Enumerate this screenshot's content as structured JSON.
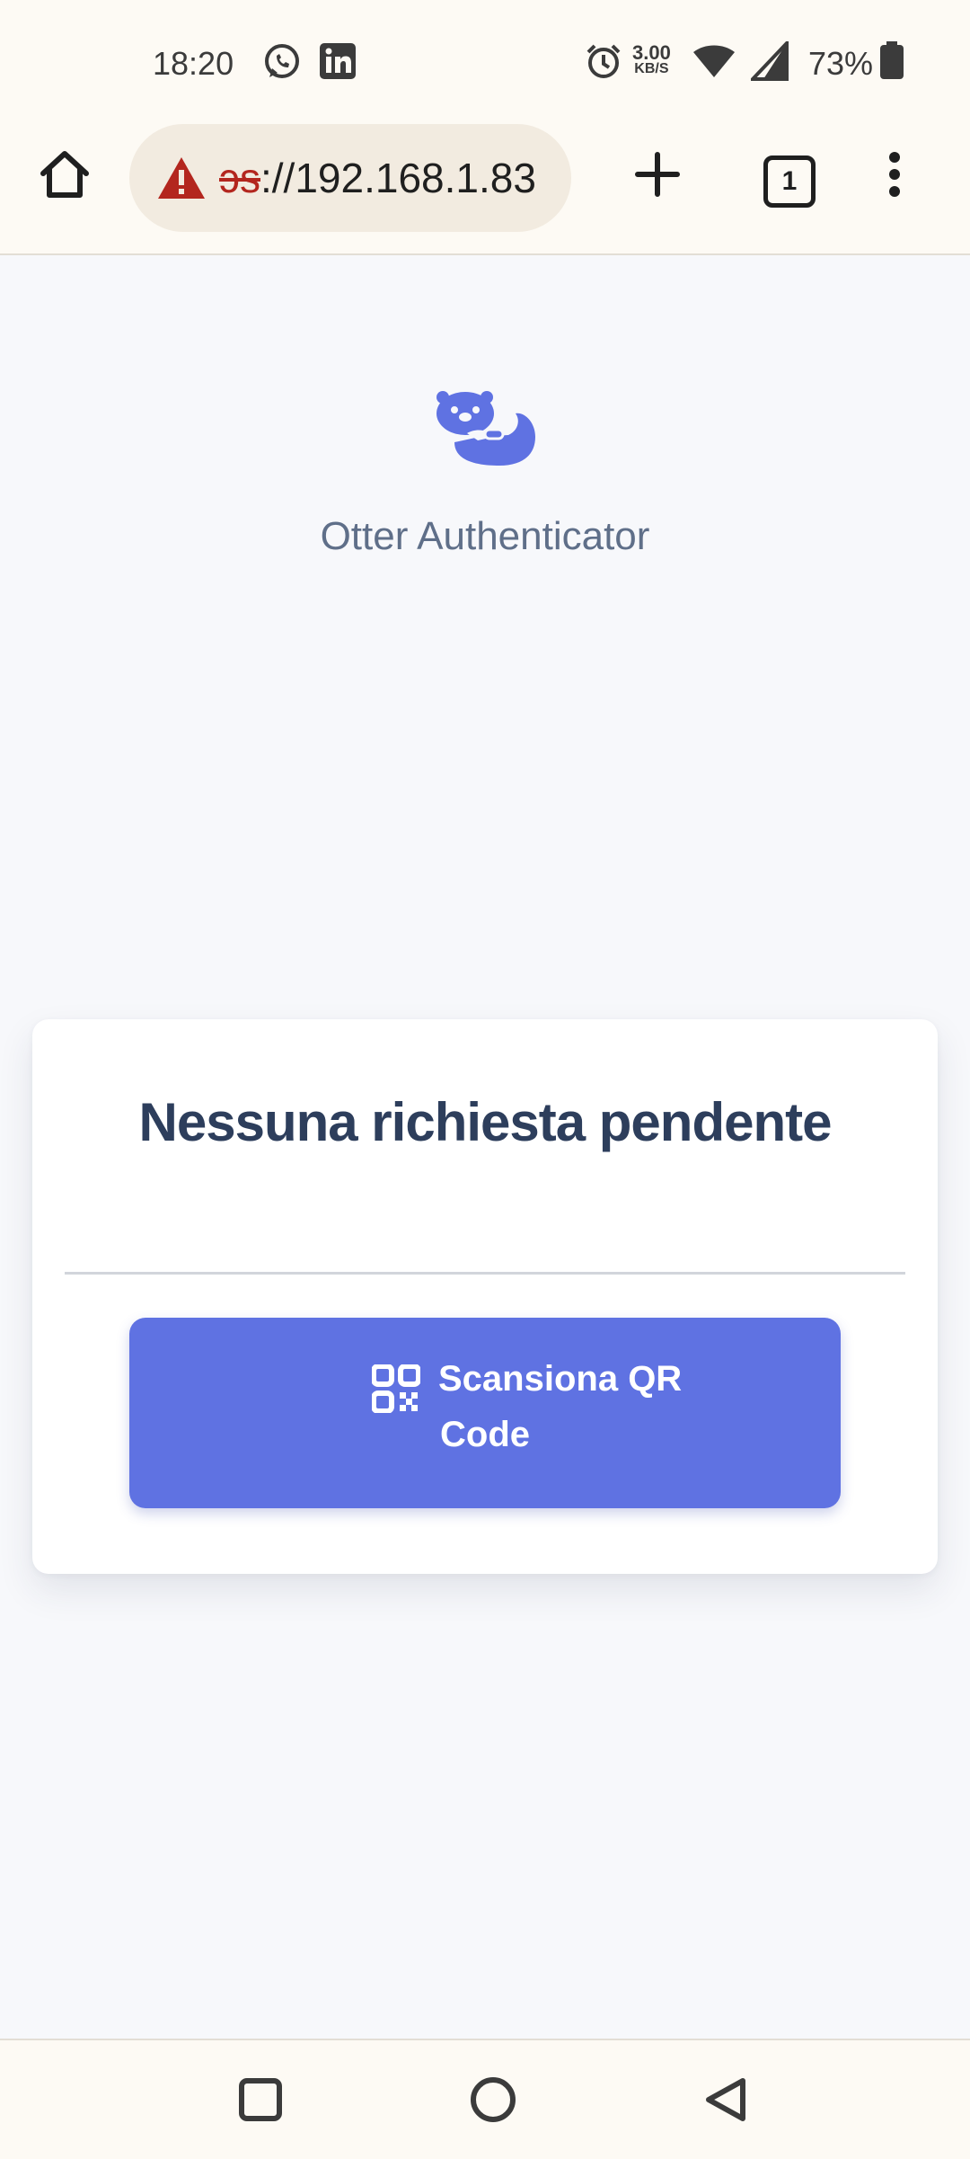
{
  "status_bar": {
    "time": "18:20",
    "net_speed_value": "3.00",
    "net_speed_unit": "KB/S",
    "battery": "73%",
    "icons": [
      "whatsapp-icon",
      "linkedin-icon",
      "alarm-icon",
      "wifi-icon",
      "signal-icon",
      "battery-icon"
    ]
  },
  "browser": {
    "url_scheme_fragment": "ɔs",
    "url_rest": "://192.168.1.83",
    "tab_count": "1",
    "icons": [
      "home-icon",
      "warning-icon",
      "plus-icon",
      "menu-icon"
    ]
  },
  "app": {
    "name": "Otter Authenticator",
    "logo_color": "#5f72e2"
  },
  "card": {
    "title": "Nessuna richiesta pendente",
    "scan_button_line1": "Scansiona QR",
    "scan_button_line2": "Code"
  },
  "colors": {
    "accent": "#5f72e2",
    "title": "#2d3e5c",
    "subtitle": "#5f6f89",
    "warning": "#b3261e"
  }
}
